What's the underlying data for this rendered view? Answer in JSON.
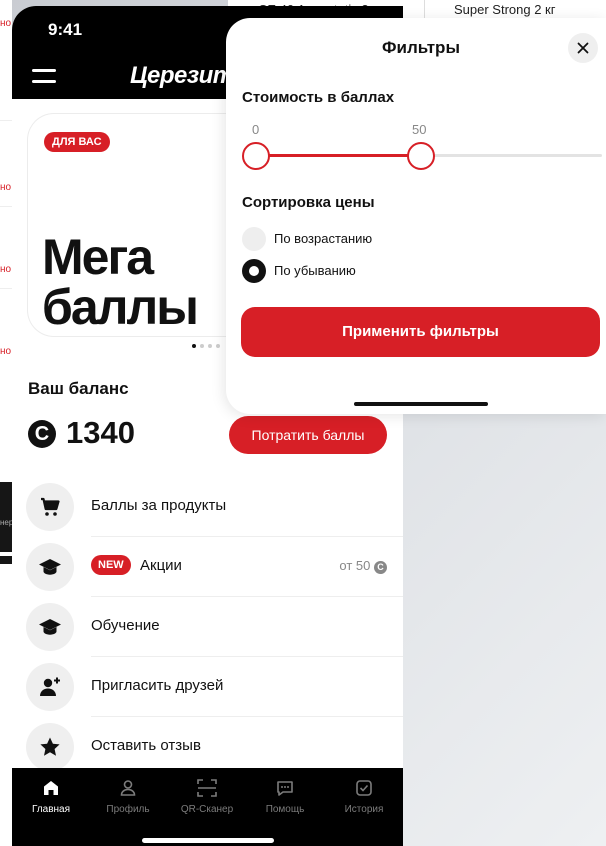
{
  "background": {
    "top_products": [
      "CE 40 Aquastatic 2 кг",
      "Super Strong 2 кг"
    ],
    "left_fragment_text": "но",
    "left_dark_text": "нер"
  },
  "status_bar": {
    "time": "9:41"
  },
  "header": {
    "brand": "Церезит",
    "menu_icon": "hamburger-icon"
  },
  "promo": {
    "badge": "ДЛЯ ВАС",
    "title_line1": "Мега",
    "title_line2": "баллы"
  },
  "balance": {
    "label": "Ваш баланс",
    "currency_icon": "C",
    "value": "1340",
    "spend_button": "Потратить баллы"
  },
  "menu": [
    {
      "label": "Баллы за продукты",
      "icon": "cart-icon"
    },
    {
      "label": "Акции",
      "icon": "graduation-cap-icon",
      "badge": "NEW",
      "extra": "от 50",
      "extra_icon": "C"
    },
    {
      "label": "Обучение",
      "icon": "graduation-cap-icon"
    },
    {
      "label": "Пригласить друзей",
      "icon": "add-user-icon"
    },
    {
      "label": "Оставить отзыв",
      "icon": "star-icon"
    }
  ],
  "tabbar": [
    {
      "label": "Главная",
      "icon": "home-icon",
      "active": true
    },
    {
      "label": "Профиль",
      "icon": "profile-icon"
    },
    {
      "label": "QR-Сканер",
      "icon": "qr-scanner-icon"
    },
    {
      "label": "Помощь",
      "icon": "chat-icon"
    },
    {
      "label": "История",
      "icon": "history-icon"
    }
  ],
  "filters": {
    "title": "Фильтры",
    "cost_section": "Стоимость в баллах",
    "range_min_label": "0",
    "range_max_label": "50",
    "range_min_value": 0,
    "range_max_value": 50,
    "sort_section": "Сортировка цены",
    "sort_options": [
      "По возрастанию",
      "По убыванию"
    ],
    "sort_selected": "По убыванию",
    "apply_button": "Применить фильтры"
  },
  "colors": {
    "accent": "#d71f26",
    "dark": "#000000",
    "surface": "#ffffff"
  }
}
